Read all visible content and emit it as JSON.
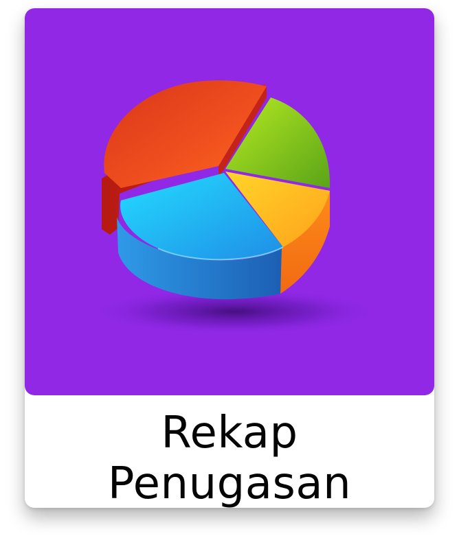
{
  "tile": {
    "label_lines": [
      "Rekap",
      "Penugasan"
    ],
    "icon": "pie-chart-3d-icon",
    "background_color": "#9028e6",
    "slice_colors": {
      "red": "#ea4a1c",
      "green": "#8fd21e",
      "orange": "#ffb01e",
      "blue": "#27aef0"
    }
  }
}
